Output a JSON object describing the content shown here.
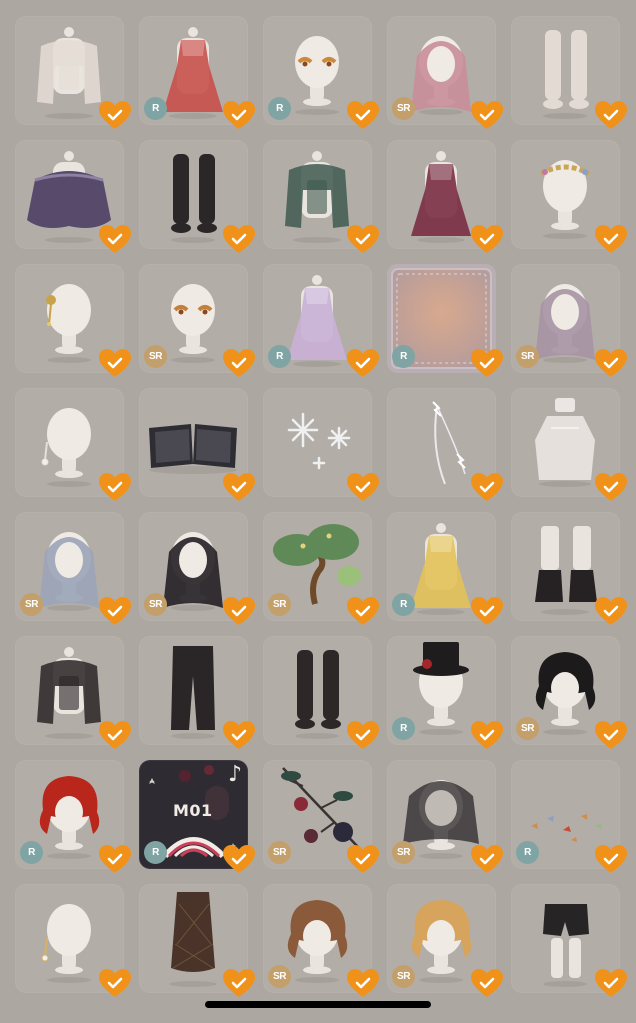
{
  "items": [
    {
      "name": "cream-cardigan",
      "rarity": "",
      "art": "top",
      "color": "#e5ddd5",
      "favorite": true
    },
    {
      "name": "red-floral-dress",
      "rarity": "R",
      "art": "dress",
      "color": "#c8504a",
      "favorite": true
    },
    {
      "name": "golden-eye-makeup",
      "rarity": "R",
      "art": "eyes",
      "color": "#c98a3e",
      "favorite": true
    },
    {
      "name": "pink-long-hair",
      "rarity": "SR",
      "art": "hair-long",
      "color": "#c98e9a",
      "favorite": true
    },
    {
      "name": "white-stockings",
      "rarity": "",
      "art": "socks",
      "color": "#e3dbd3",
      "favorite": true
    },
    {
      "name": "purple-cape",
      "rarity": "",
      "art": "cape",
      "color": "#574a6b",
      "favorite": true
    },
    {
      "name": "black-stockings",
      "rarity": "",
      "art": "socks",
      "color": "#2b2729",
      "favorite": true
    },
    {
      "name": "green-vest-blouse",
      "rarity": "",
      "art": "top",
      "color": "#3f5a50",
      "favorite": true
    },
    {
      "name": "maroon-robe",
      "rarity": "",
      "art": "dress",
      "color": "#7a2e45",
      "favorite": true
    },
    {
      "name": "flower-crown",
      "rarity": "",
      "art": "crown",
      "color": "#c9a55a",
      "favorite": true
    },
    {
      "name": "gold-hair-clip",
      "rarity": "",
      "art": "clip",
      "color": "#c9a34a",
      "favorite": true
    },
    {
      "name": "amber-eye-makeup",
      "rarity": "SR",
      "art": "eyes",
      "color": "#c47f3a",
      "favorite": true
    },
    {
      "name": "pastel-starry-dress",
      "rarity": "R",
      "art": "dress",
      "color": "#c9b0d6",
      "favorite": true
    },
    {
      "name": "sunset-backdrop",
      "rarity": "R",
      "art": "backdrop",
      "color": "#d6a07e",
      "favorite": true
    },
    {
      "name": "lilac-long-hair",
      "rarity": "SR",
      "art": "hair-long",
      "color": "#a693a4",
      "favorite": true
    },
    {
      "name": "pearl-earring",
      "rarity": "",
      "art": "earring",
      "color": "#e6e0da",
      "favorite": true
    },
    {
      "name": "open-black-book",
      "rarity": "",
      "art": "book",
      "color": "#2e2d33",
      "favorite": true
    },
    {
      "name": "snowflake-effect",
      "rarity": "",
      "art": "snow",
      "color": "#eef0f2",
      "favorite": true
    },
    {
      "name": "lightning-wisp",
      "rarity": "",
      "art": "wisp",
      "color": "#e9e9ee",
      "favorite": true
    },
    {
      "name": "perfume-bottle",
      "rarity": "",
      "art": "bottle",
      "color": "#ebe6e3",
      "favorite": true
    },
    {
      "name": "silver-flowing-hair",
      "rarity": "SR",
      "art": "hair-long",
      "color": "#9aa4b8",
      "favorite": true
    },
    {
      "name": "black-wavy-hair",
      "rarity": "SR",
      "art": "hair-long",
      "color": "#232025",
      "favorite": true
    },
    {
      "name": "bonsai-tree",
      "rarity": "SR",
      "art": "tree",
      "color": "#5f8a57",
      "favorite": true
    },
    {
      "name": "yellow-sunflower-dress",
      "rarity": "R",
      "art": "dress",
      "color": "#e3c25a",
      "favorite": true
    },
    {
      "name": "black-boots",
      "rarity": "",
      "art": "boots",
      "color": "#262224",
      "favorite": true
    },
    {
      "name": "black-vest-shirt",
      "rarity": "",
      "art": "top",
      "color": "#2a2526",
      "favorite": true
    },
    {
      "name": "black-trousers",
      "rarity": "",
      "art": "pants",
      "color": "#2a2526",
      "favorite": true
    },
    {
      "name": "lace-up-boots",
      "rarity": "",
      "art": "socks",
      "color": "#2d2728",
      "favorite": true
    },
    {
      "name": "black-top-hat",
      "rarity": "R",
      "art": "tophat",
      "color": "#1f1c1e",
      "favorite": true
    },
    {
      "name": "split-color-hair",
      "rarity": "SR",
      "art": "hair-short",
      "color": "#1d1a1c",
      "favorite": true
    },
    {
      "name": "red-curly-hair",
      "rarity": "R",
      "art": "hair-short",
      "color": "#b8261c",
      "favorite": true
    },
    {
      "name": "m01-record",
      "rarity": "R",
      "art": "record",
      "color": "#2e2c32",
      "favorite": true,
      "dark": true
    },
    {
      "name": "blackberry-branch",
      "rarity": "SR",
      "art": "berries",
      "color": "#2b2a3a",
      "favorite": true
    },
    {
      "name": "black-lace-veil",
      "rarity": "SR",
      "art": "veil",
      "color": "#2a2628",
      "favorite": true
    },
    {
      "name": "autumn-leaves",
      "rarity": "R",
      "art": "leaves",
      "color": "#d08c4a",
      "favorite": true
    },
    {
      "name": "dangle-earring",
      "rarity": "",
      "art": "earring",
      "color": "#d9b26a",
      "favorite": true
    },
    {
      "name": "plaid-brown-skirt",
      "rarity": "",
      "art": "skirt",
      "color": "#4a3429",
      "favorite": true
    },
    {
      "name": "brown-curly-bob",
      "rarity": "SR",
      "art": "hair-short",
      "color": "#8a5a3a",
      "favorite": true
    },
    {
      "name": "blonde-braided-hair",
      "rarity": "SR",
      "art": "hair-short",
      "color": "#d6a45c",
      "favorite": true
    },
    {
      "name": "black-shorts",
      "rarity": "",
      "art": "shorts",
      "color": "#272426",
      "favorite": true
    }
  ],
  "record_label": "M01",
  "record_note": "♪",
  "favorite_color": "#f0921a"
}
